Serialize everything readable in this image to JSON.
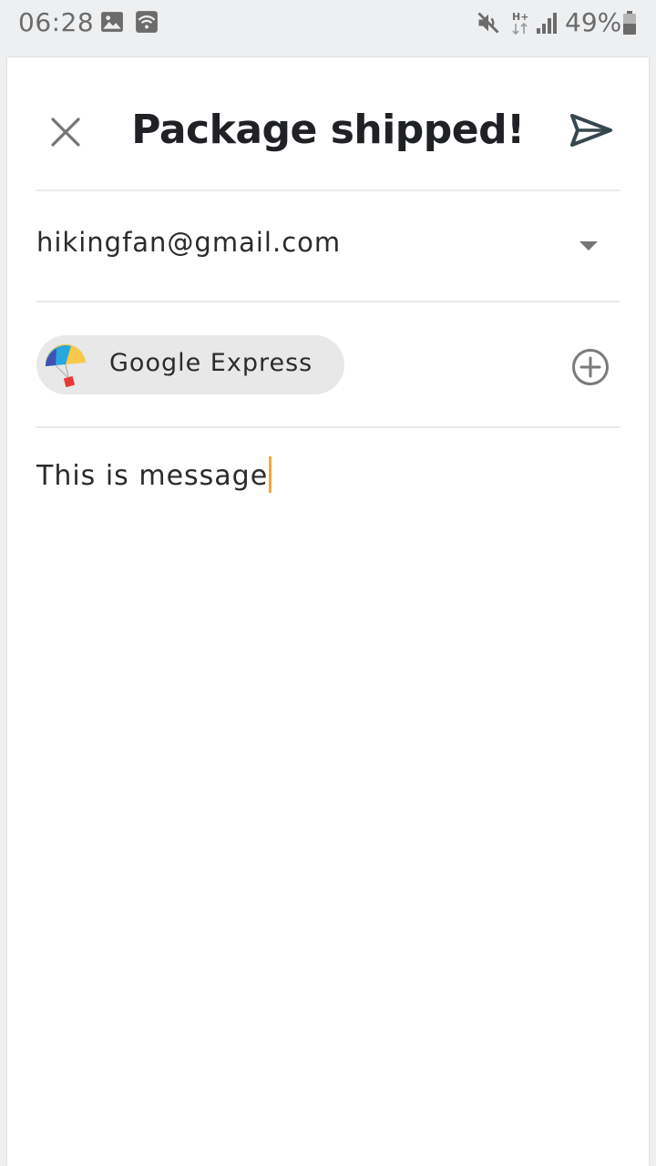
{
  "status_bar": {
    "time": "06:28",
    "battery": "49%",
    "icons": [
      "image-icon",
      "wifi-icon",
      "mute-icon",
      "hplus-data-icon",
      "signal-icon",
      "battery-icon"
    ]
  },
  "compose": {
    "title": "Package shipped!",
    "account": "hikingfan@gmail.com",
    "chip_label": "Google Express",
    "message": "This is message"
  },
  "colors": {
    "background": "#eeeff1",
    "caret": "#f2a83b",
    "send_icon": "#37474f",
    "chip": "#e8e8e8"
  }
}
